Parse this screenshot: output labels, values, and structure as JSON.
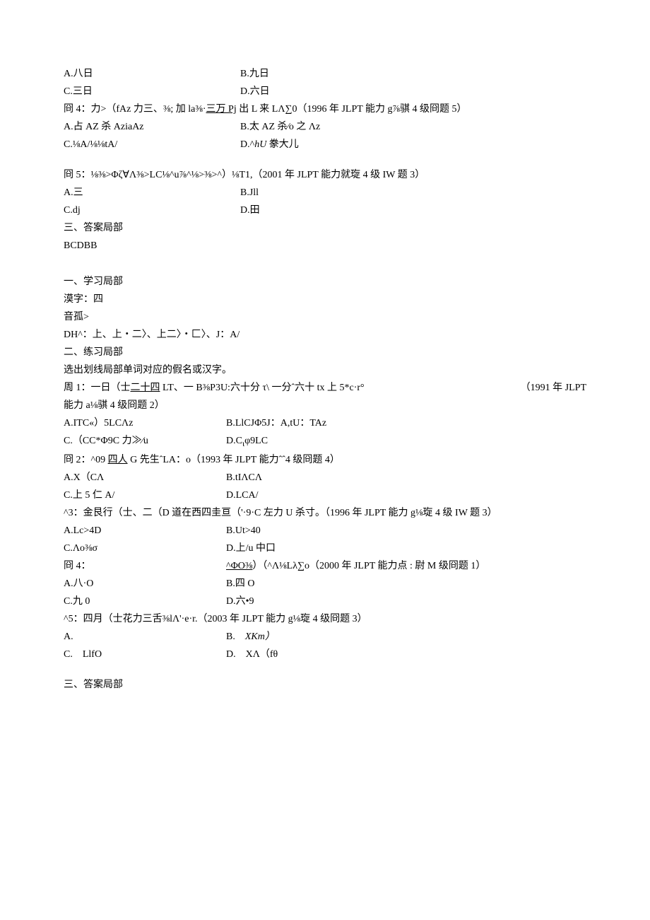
{
  "top": {
    "row1": {
      "a": "A.八日",
      "b": "B.九日"
    },
    "row2": {
      "a": "C.三日",
      "b": "D.六日"
    },
    "q4": "冏 4：力>（fAz 力三、⅜; 加 la⅜·三万 Pj 出 L 来 LΛ∑0（1996 年 JLPT 能力 g⅞骐 4 级冏题 5）",
    "q4row1": {
      "a": "A.占 AZ 杀 AziaAz",
      "b": "B.太 AZ 杀⁄o 之 Λz"
    },
    "q4row2": {
      "a": "C.⅛A/⅛⅛tA/",
      "b": "D.^hU 豢大儿"
    },
    "q5": "冏 5：⅛⅜>Φζ∀Λ⅜>LC⅛^u⅞^⅛>⅜>^）⅛T1,（2001 年 JLPT 能力就琁 4 级 IW 题 3）",
    "q5row1": {
      "a": "A.三",
      "b": "B.Jll"
    },
    "q5row2": {
      "a": "C.dj",
      "b": "D.田"
    },
    "answersLabel": "三、答案局部",
    "answers": "BCDBB"
  },
  "sec2": {
    "learnLabel": "一、学习局部",
    "kanji": "漠字：四",
    "onyomi": "音孤>",
    "dh": "DH^：上、上・二〉、上二〉・匚〉、J：A/",
    "practiceLabel": "二、练习局部",
    "instruction": "选出划线局部单词对应的假名或汉字。",
    "q1main": "周 1：一日（士二十四 LT、一 B⅜P3U:六十分 τ\\ 一分ˆ六十 tx 上 5*c·r°",
    "q1tail": "（1991 年 JLPT",
    "q1cont": "能力 a⅛骐 4 级冏题 2）",
    "q1row1": {
      "a": "A.ITC«）5LCΛz",
      "b": "B.LlCJΦ5J：A,tU：TAz"
    },
    "q1row2": {
      "a": "C.（CC*Φ9C 力≫⁄u",
      "b": "D.CιΦ9LC"
    },
    "q2": "冏 2：^09 四人 G 先生ˆLA：o（1993 年 JLPT 能力ˆˆ4 级冏题 4）",
    "q2row1": {
      "a": "A.X（CΛ",
      "b": "B.tIΛCΛ"
    },
    "q2row2": {
      "a": "C.上 5 仁 A/",
      "b": "D.LCA/"
    },
    "q3": "^3：金艮行（士、二（D 道在西四圭亘（'·9·C 左力 U 杀寸。（1996 年 JLPT 能力 g⅛琁 4 级 IW 题 3）",
    "q3row1": {
      "a": "A.Lc>4D",
      "b": "B.Ut>40"
    },
    "q3row2": {
      "a": "C.Λo⅜σ",
      "b": "D.上/u 中口"
    },
    "q4leading": "冏 4：",
    "q4rest": "^ΦO⅜）（^Λ⅛Lλ∑o（2000 年 JLPT 能力点 : 尉 M 级冏题 1）",
    "q4row1": {
      "a": "A.八·O",
      "b": "B.四 O"
    },
    "q4row2": {
      "a": "C.九 0",
      "b": "D.六•9"
    },
    "q5": "^5：四月（士花力三舌⅜lΛ'·e·r.（2003 年 JLPT 能力 g⅛琁 4 级冏题 3）",
    "q5row1": {
      "a": "A.",
      "b": "B. XKm）"
    },
    "q5row2": {
      "a": "C. LlfO",
      "b": "D. XΛ（fθ"
    },
    "answersLabel": "三、答案局部"
  }
}
